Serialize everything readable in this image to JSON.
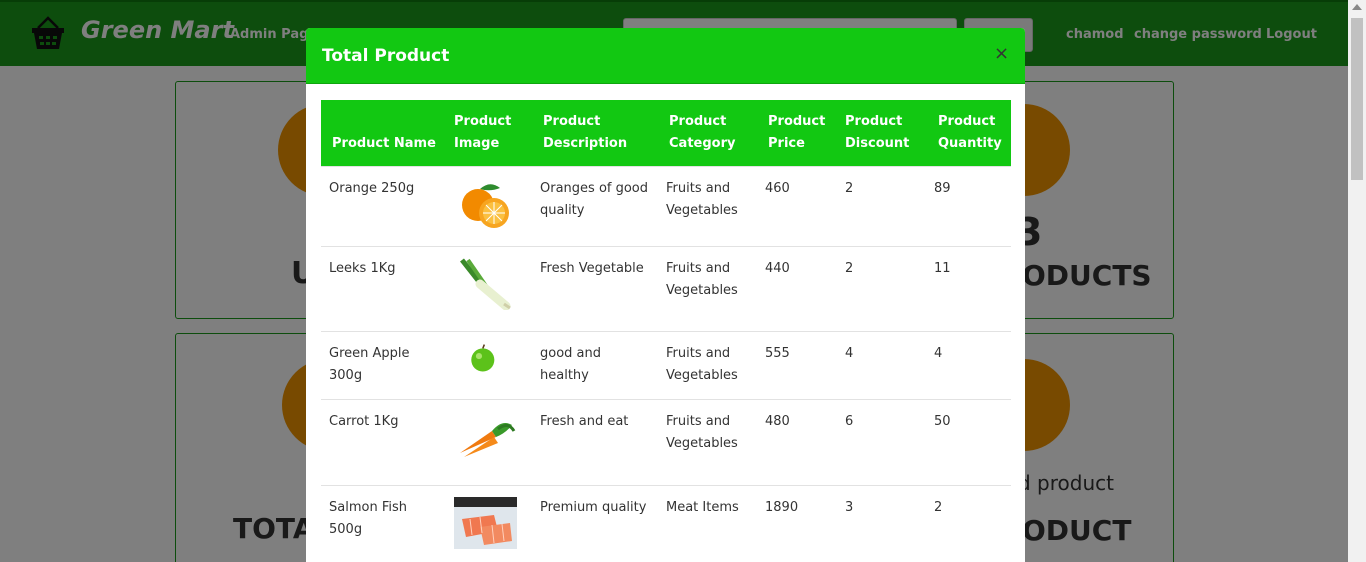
{
  "navbar": {
    "brand": "Green Mart",
    "admin_page": "Admin Page",
    "user": "chamod",
    "change_password": "change password",
    "logout": "Logout"
  },
  "dashboard": {
    "users_fragment": "U",
    "products_count_fragment": "3",
    "products_fragment": "ODUCTS",
    "total_fragment": "TOTAL",
    "added_product_fragment": "d product",
    "product_fragment": "ODUCT"
  },
  "modal": {
    "title": "Total Product",
    "close": "×",
    "columns": [
      "Product Name",
      "Product Image",
      "Product Description",
      "Product Category",
      "Product Price",
      "Product Discount",
      "Product Quantity"
    ],
    "rows": [
      {
        "name": "Orange 250g",
        "image": "orange-image",
        "description": "Oranges of good quality",
        "category": "Fruits and Vegetables",
        "price": "460",
        "discount": "2",
        "quantity": "89"
      },
      {
        "name": "Leeks 1Kg",
        "image": "leeks-image",
        "description": "Fresh Vegetable",
        "category": "Fruits and Vegetables",
        "price": "440",
        "discount": "2",
        "quantity": "11"
      },
      {
        "name": "Green Apple 300g",
        "image": "green-apple-image",
        "description": "good and healthy",
        "category": "Fruits and Vegetables",
        "price": "555",
        "discount": "4",
        "quantity": "4"
      },
      {
        "name": "Carrot 1Kg",
        "image": "carrot-image",
        "description": "Fresh and eat",
        "category": "Fruits and Vegetables",
        "price": "480",
        "discount": "6",
        "quantity": "50"
      },
      {
        "name": "Salmon Fish 500g",
        "image": "salmon-image",
        "description": "Premium quality",
        "category": "Meat Items",
        "price": "1890",
        "discount": "3",
        "quantity": "2"
      }
    ]
  },
  "colors": {
    "navbar": "#1a9a1a",
    "modal_header": "#12c812",
    "accent_circle": "#f09500"
  }
}
